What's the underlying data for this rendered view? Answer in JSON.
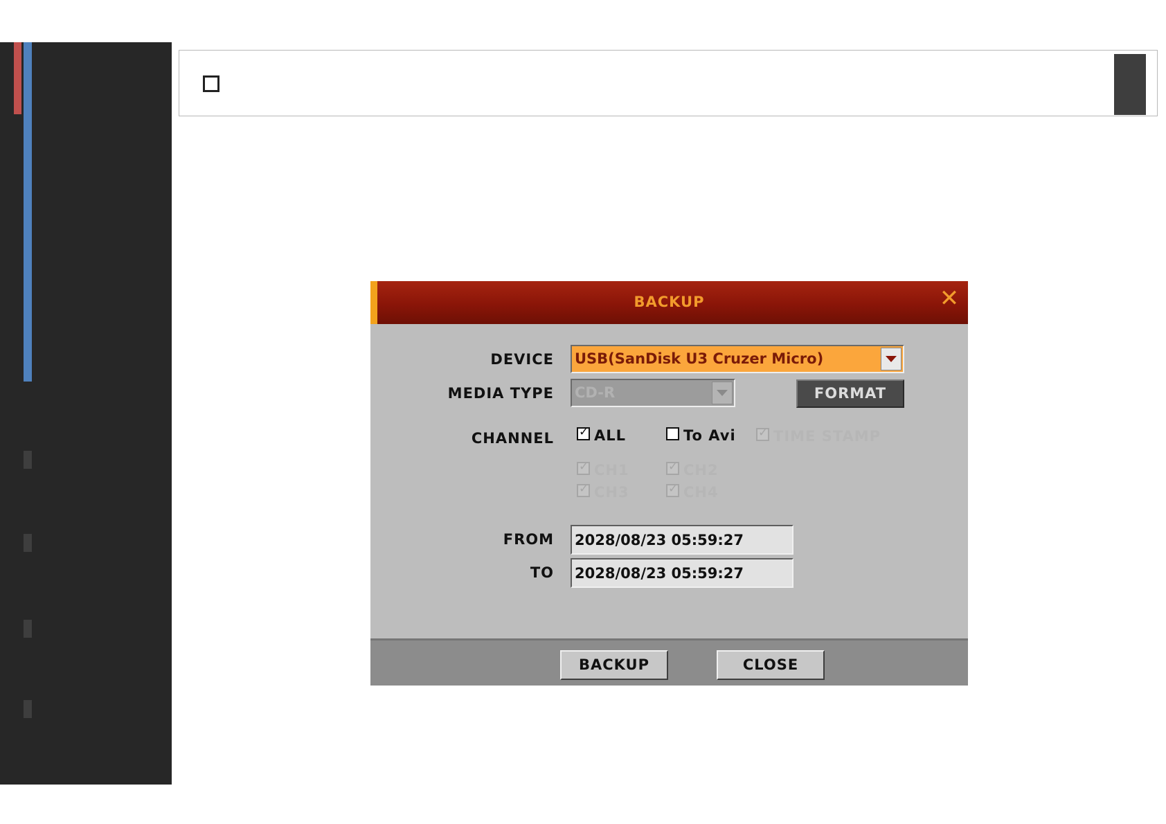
{
  "dialog": {
    "title": "BACKUP",
    "close_icon": "close-icon",
    "labels": {
      "device": "DEVICE",
      "media_type": "MEDIA TYPE",
      "channel": "CHANNEL",
      "from": "FROM",
      "to": "TO"
    },
    "device_value": "USB(SanDisk U3 Cruzer Micro)",
    "media_type_value": "CD-R",
    "format_label": "FORMAT",
    "channel": {
      "all_label": "ALL",
      "to_avi_label": "To Avi",
      "time_stamp_label": "TIME STAMP",
      "ch1": "CH1",
      "ch2": "CH2",
      "ch3": "CH3",
      "ch4": "CH4"
    },
    "from_value": "2028/08/23 05:59:27",
    "to_value": "2028/08/23 05:59:27",
    "backup_label": "BACKUP",
    "close_label": "CLOSE"
  },
  "colors": {
    "title_bar": "#8a1508",
    "title_text": "#f29b2c",
    "device_select": "#fba63c",
    "dialog_body": "#bdbdbd",
    "sidebar": "#272727"
  }
}
